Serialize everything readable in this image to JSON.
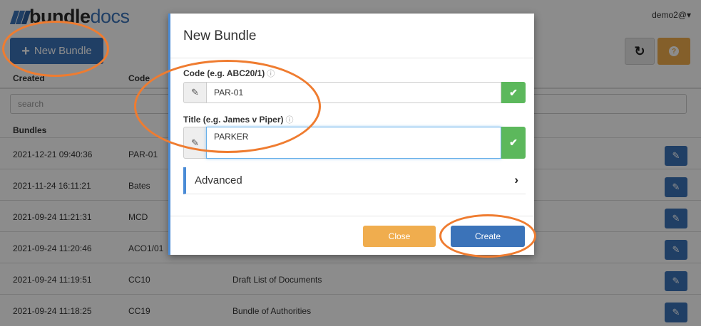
{
  "brand": {
    "word1": "bundle",
    "word2": "docs"
  },
  "user_menu": "demo2@▾",
  "toolbar": {
    "new_bundle_label": "New Bundle",
    "new_bundle_icon": "+",
    "refresh_icon": "↻",
    "help_icon": "?"
  },
  "table": {
    "headers": {
      "created": "Created",
      "code": "Code"
    },
    "search_placeholder": "search",
    "section_label": "Bundles",
    "rows": [
      {
        "created": "2021-12-21 09:40:36",
        "code": "PAR-01",
        "title": ""
      },
      {
        "created": "2021-11-24 16:11:21",
        "code": "Bates",
        "title": ""
      },
      {
        "created": "2021-09-24 11:21:31",
        "code": "MCD",
        "title": ""
      },
      {
        "created": "2021-09-24 11:20:46",
        "code": "ACO1/01",
        "title": ""
      },
      {
        "created": "2021-09-24 11:19:51",
        "code": "CC10",
        "title": "Draft List of Documents"
      },
      {
        "created": "2021-09-24 11:18:25",
        "code": "CC19",
        "title": "Bundle of Authorities"
      }
    ],
    "edit_icon": "✎"
  },
  "modal": {
    "title": "New Bundle",
    "code_label": "Code (e.g. ABC20/1)",
    "code_value": "PAR-01",
    "title_label": "Title (e.g. James v Piper)",
    "title_value": "PARKER",
    "info_icon": "ⓘ",
    "edit_icon": "✎",
    "check_icon": "✔",
    "advanced_label": "Advanced",
    "chevron": "›",
    "close_label": "Close",
    "create_label": "Create"
  },
  "colors": {
    "primary": "#3b73b9",
    "warning": "#f0ad4e",
    "success": "#5cb85c",
    "annotation": "#ef7c30"
  }
}
